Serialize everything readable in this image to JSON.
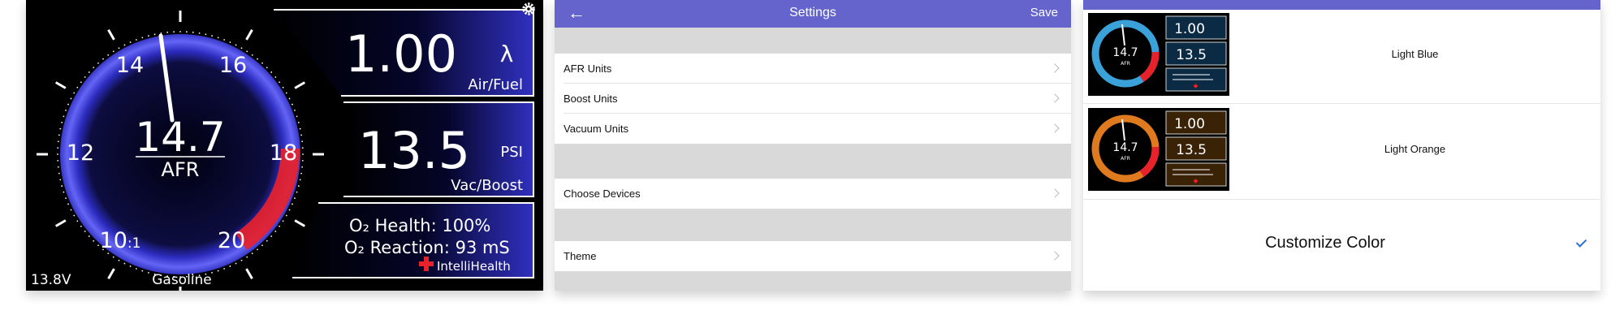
{
  "gauge": {
    "ticks": [
      "14",
      "16",
      "12",
      "18",
      "10",
      "20"
    ],
    "ratio_suffix": ":1",
    "afr_value": "14.7",
    "afr_label": "AFR",
    "afr_numeric": 14.7,
    "voltage": "13.8V",
    "fuel": "Gasoline",
    "lambda_value": "1.00",
    "lambda_symbol": "λ",
    "lambda_label": "Air/Fuel",
    "boost_value": "13.5",
    "boost_unit": "PSI",
    "boost_label": "Vac/Boost",
    "o2_health": "O₂ Health: 100%",
    "o2_reaction": "O₂ Reaction: 93 mS",
    "intellihealth": "IntelliHealth",
    "colors": {
      "ring_blue": "#5b5bf0",
      "ring_red": "#e8212a",
      "panel_blue": "#2c2cb8"
    }
  },
  "settings": {
    "title": "Settings",
    "back_icon": "arrow-left-icon",
    "save_label": "Save",
    "rows": [
      {
        "label": "AFR Units"
      },
      {
        "label": "Boost Units"
      },
      {
        "label": "Vacuum Units"
      },
      {
        "label": "Choose Devices"
      },
      {
        "label": "Theme"
      }
    ],
    "header_color": "#6464cc"
  },
  "themes": {
    "options": [
      {
        "label": "Light Blue",
        "ring_color": "#3aa2d8"
      },
      {
        "label": "Light Orange",
        "ring_color": "#e07a1f"
      }
    ],
    "customize_label": "Customize Color",
    "check_icon": "checkmark-icon",
    "selected": "Customize Color"
  }
}
